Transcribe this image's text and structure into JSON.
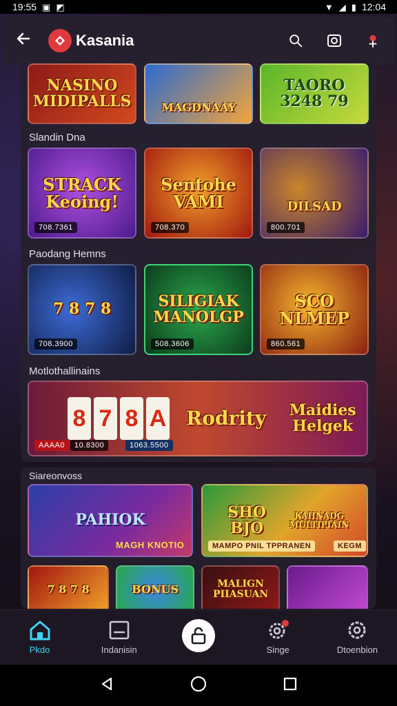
{
  "status_bar": {
    "time_left": "19:55",
    "time_right": "12:04"
  },
  "app_bar": {
    "title": "Kasania"
  },
  "sections": [
    {
      "title": "",
      "tiles": [
        {
          "text": "NASINO MIDIPALLS",
          "badge": ""
        },
        {
          "text": "MAGDNAAY",
          "badge": ""
        },
        {
          "text": "TAORO 3248 79",
          "badge": ""
        }
      ]
    },
    {
      "title": "Slandin Dna",
      "tiles": [
        {
          "text": "STRACK Keoing!",
          "badge": "708.7361"
        },
        {
          "text": "Sentohe VAMI",
          "badge": "708.370"
        },
        {
          "text": "DILSAD",
          "badge": "800.701"
        }
      ]
    },
    {
      "title": "Paodang Hemns",
      "tiles": [
        {
          "text": "7 8 7 8",
          "badge": "708.3900"
        },
        {
          "text": "SILIGIAK MANOLGP",
          "badge": "508.3606"
        },
        {
          "text": "SCO NLMEP",
          "badge": "860.561"
        }
      ]
    },
    {
      "title": "Motlothallinains",
      "banner": {
        "reels": [
          "8",
          "7",
          "8",
          "A"
        ],
        "left_badge": "AAAA0",
        "mid_badge": "10.8300",
        "right_badge": "1063.5500",
        "text1": "Rodrity",
        "text2": "Maidies Helgek"
      }
    },
    {
      "title": "Siareonvoss",
      "tiles": [
        {
          "text": "PAHIOK",
          "caption": "MAGH KNOTIO"
        },
        {
          "text": "SHO BJO",
          "caption": "MAMPO PNIL TPPRANEN"
        },
        {
          "text": "KAHNADG MULTIPIAIN",
          "caption": "KEGM"
        }
      ],
      "small_tiles": [
        {
          "text": "7 8 7 8"
        },
        {
          "text": "BONUS"
        },
        {
          "text": "MALIGN PIIASUAN"
        },
        {
          "text": ""
        }
      ]
    }
  ],
  "bottom_nav": [
    {
      "label": "Pkdo",
      "icon": "home-icon"
    },
    {
      "label": "Indanisin",
      "icon": "tray-icon"
    },
    {
      "label": "",
      "icon": "unlock-icon"
    },
    {
      "label": "Singe",
      "icon": "gear-badge-icon"
    },
    {
      "label": "Dtoenbion",
      "icon": "settings-icon"
    }
  ],
  "colors": {
    "accent": "#3fd3f5",
    "brand": "#e03a3e"
  }
}
